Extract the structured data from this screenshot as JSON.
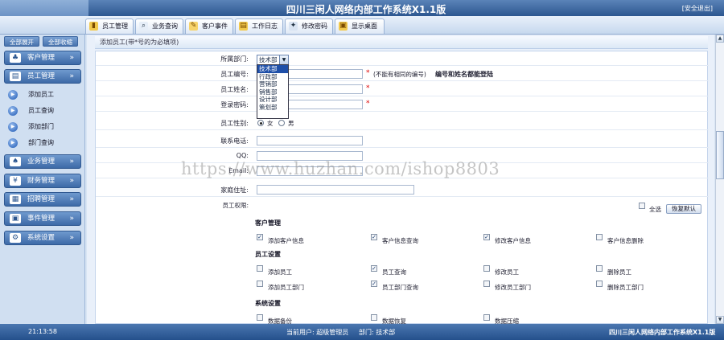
{
  "app": {
    "title": "四川三闲人网络内部工作系统X1.1版",
    "logout": "[安全退出]"
  },
  "tabs": [
    {
      "label": "员工管理",
      "icon": "employee-icon"
    },
    {
      "label": "业务查询",
      "icon": "search-icon"
    },
    {
      "label": "客户事件",
      "icon": "customer-icon"
    },
    {
      "label": "工作日志",
      "icon": "log-icon"
    },
    {
      "label": "修改密码",
      "icon": "password-icon"
    },
    {
      "label": "显示桌面",
      "icon": "desktop-icon"
    }
  ],
  "sidebar": {
    "expand_all": "全部展开",
    "collapse_all": "全部收缩",
    "menus": [
      "客户管理",
      "员工管理",
      "业务管理",
      "财务管理",
      "招聘管理",
      "事件管理",
      "系统设置"
    ],
    "submenu": [
      "添加员工",
      "员工查询",
      "添加部门",
      "部门查询"
    ]
  },
  "form": {
    "header": "添加员工(带*号的为必填项)",
    "labels": {
      "dept": "所属部门:",
      "emp_no": "员工编号:",
      "name": "员工姓名:",
      "password": "登录密码:",
      "gender": "员工性别:",
      "phone": "联系电话:",
      "qq": "QQ:",
      "email": "Email:",
      "address": "家庭住址:",
      "perm": "员工权限:"
    },
    "dept_selected": "技术部",
    "dept_options": [
      "技术部",
      "行政部",
      "营销部",
      "销售部",
      "设计部",
      "策划部"
    ],
    "required_mark": "*",
    "emp_no_hint": "(不能有相同的编号)",
    "emp_no_hint_bold": "编号和姓名都能登陆",
    "gender_female": "女",
    "gender_male": "男",
    "select_all": "全选",
    "restore_default": "恢复默认",
    "perm_groups": [
      {
        "title": "客户管理",
        "items": [
          {
            "label": "添加客户信息",
            "checked": true
          },
          {
            "label": "客户信息查询",
            "checked": true
          },
          {
            "label": "修改客户信息",
            "checked": true
          },
          {
            "label": "客户信息删除",
            "checked": false
          }
        ]
      },
      {
        "title": "员工设置",
        "items": [
          {
            "label": "添加员工",
            "checked": false
          },
          {
            "label": "员工查询",
            "checked": true
          },
          {
            "label": "修改员工",
            "checked": false
          },
          {
            "label": "删除员工",
            "checked": false
          },
          {
            "label": "添加员工部门",
            "checked": false
          },
          {
            "label": "员工部门查询",
            "checked": true
          },
          {
            "label": "修改员工部门",
            "checked": false
          },
          {
            "label": "删除员工部门",
            "checked": false
          }
        ]
      },
      {
        "title": "系统设置",
        "items": [
          {
            "label": "数据备份",
            "checked": false
          },
          {
            "label": "数据恢复",
            "checked": false
          },
          {
            "label": "数据压缩",
            "checked": false
          }
        ]
      }
    ]
  },
  "status": {
    "time": "21:13:58",
    "user": "当前用户: 超级管理员",
    "dept": "部门: 技术部",
    "version": "四川三闲人网络内部工作系统X1.1版"
  },
  "watermark": "https://www.huzhan.com/ishop8803"
}
